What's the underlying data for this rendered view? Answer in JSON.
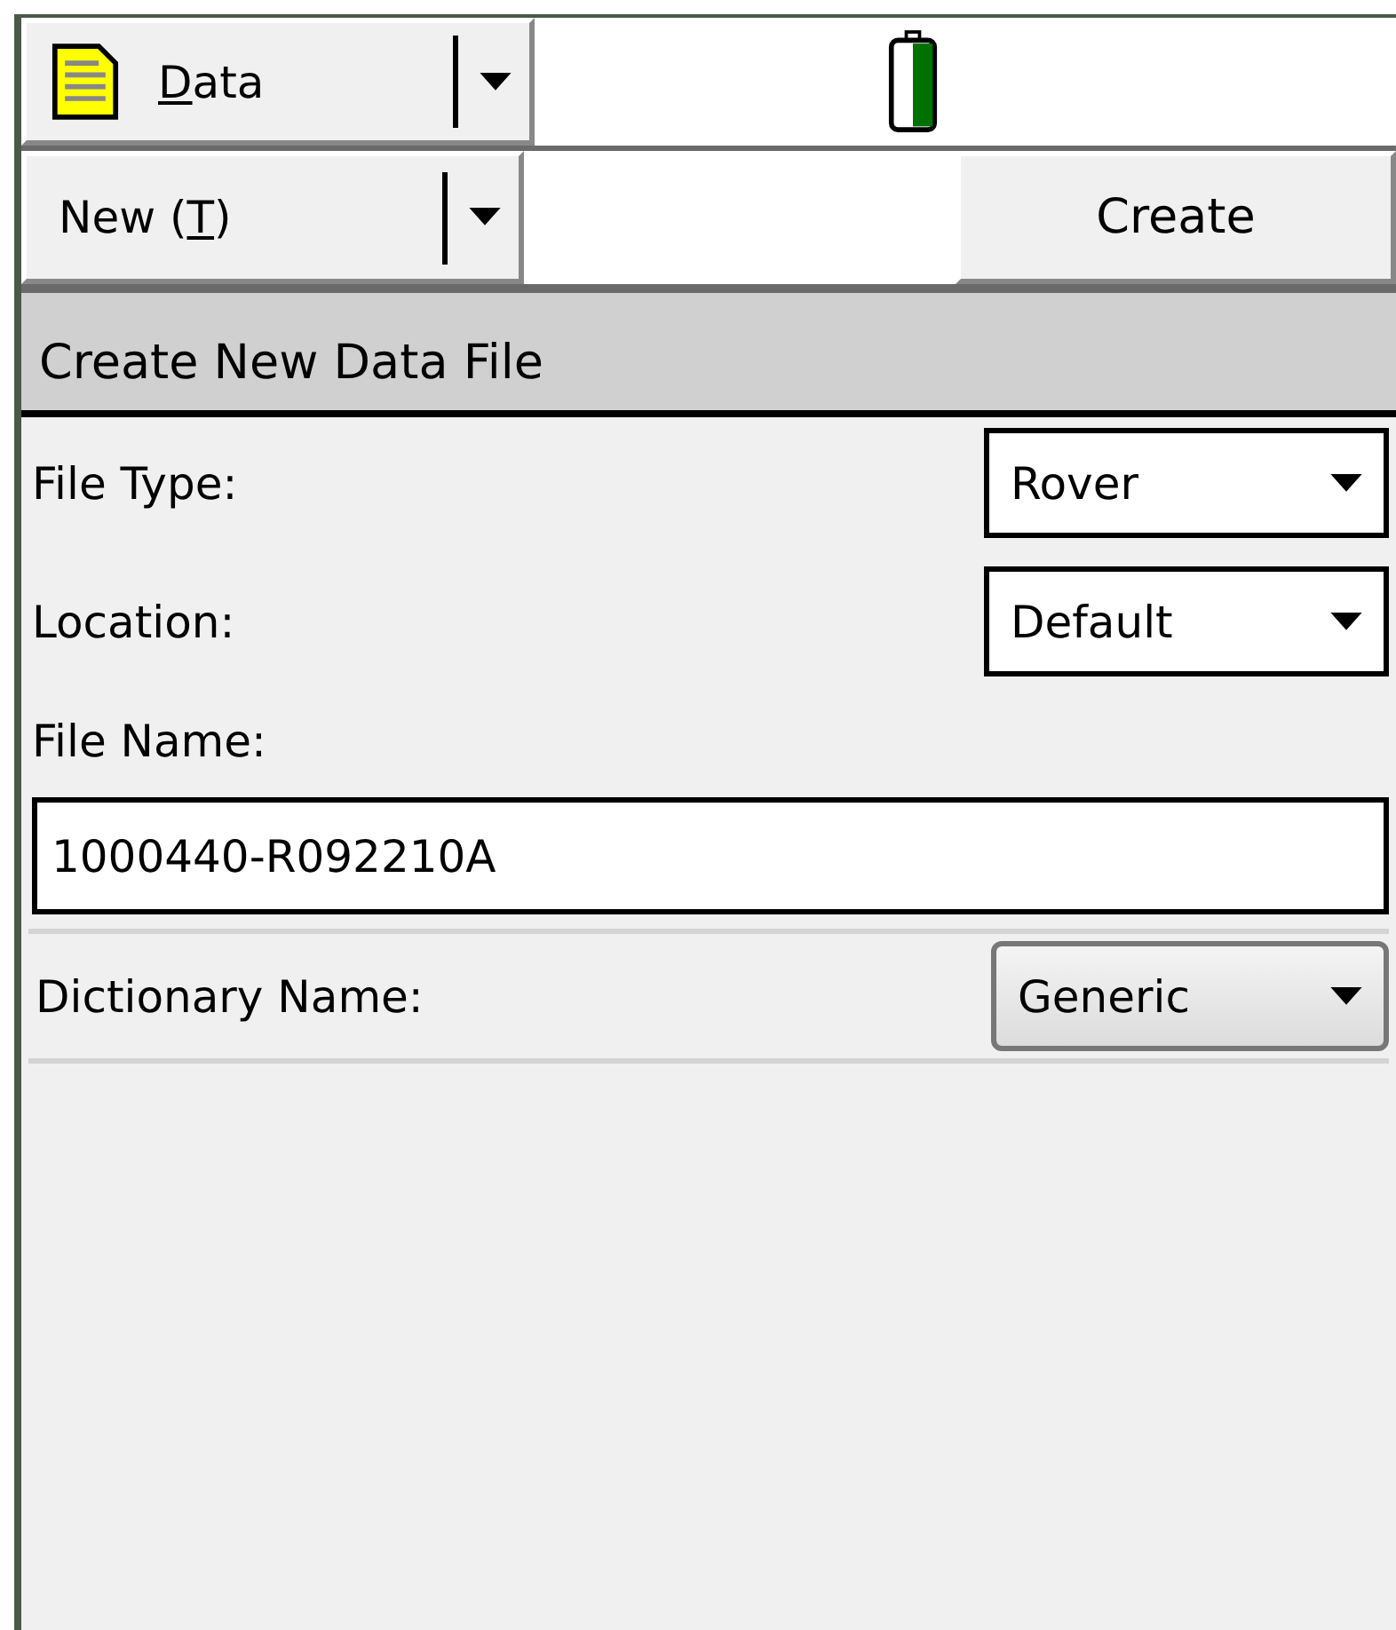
{
  "toolbar": {
    "menu_button": {
      "label": [
        {
          "text": "D",
          "underlined": true
        },
        {
          "text": "ata",
          "underlined": false
        }
      ]
    },
    "battery": {
      "kind": "charged"
    }
  },
  "command_bar": {
    "mode_button": {
      "label": [
        {
          "text": "New (",
          "underlined": false
        },
        {
          "text": "T",
          "underlined": true
        },
        {
          "text": ")",
          "underlined": false
        }
      ]
    },
    "action_button": "Create"
  },
  "section_title": "Create New Data File",
  "fields": [
    {
      "kind": "dropdown",
      "label": "File Type:",
      "value": "Rover"
    },
    {
      "kind": "dropdown",
      "label": "Location:",
      "value": "Default"
    },
    {
      "kind": "text",
      "label": "File Name:",
      "value": "1000440-R092210A"
    },
    {
      "kind": "combo",
      "label": "Dictionary Name:",
      "value": "Generic"
    }
  ]
}
